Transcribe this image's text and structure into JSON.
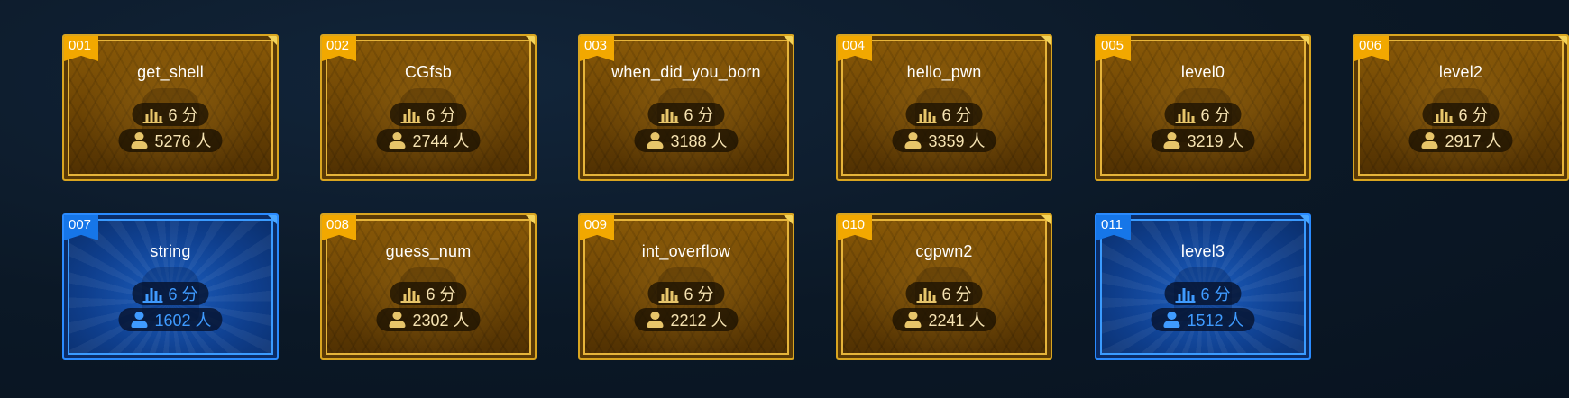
{
  "challenges": [
    {
      "number": "001",
      "name": "get_shell",
      "score": "6 分",
      "solvers": "5276 人",
      "theme": "gold"
    },
    {
      "number": "002",
      "name": "CGfsb",
      "score": "6 分",
      "solvers": "2744 人",
      "theme": "gold"
    },
    {
      "number": "003",
      "name": "when_did_you_born",
      "score": "6 分",
      "solvers": "3188 人",
      "theme": "gold"
    },
    {
      "number": "004",
      "name": "hello_pwn",
      "score": "6 分",
      "solvers": "3359 人",
      "theme": "gold"
    },
    {
      "number": "005",
      "name": "level0",
      "score": "6 分",
      "solvers": "3219 人",
      "theme": "gold"
    },
    {
      "number": "006",
      "name": "level2",
      "score": "6 分",
      "solvers": "2917 人",
      "theme": "gold"
    },
    {
      "number": "007",
      "name": "string",
      "score": "6 分",
      "solvers": "1602 人",
      "theme": "blue"
    },
    {
      "number": "008",
      "name": "guess_num",
      "score": "6 分",
      "solvers": "2302 人",
      "theme": "gold"
    },
    {
      "number": "009",
      "name": "int_overflow",
      "score": "6 分",
      "solvers": "2212 人",
      "theme": "gold"
    },
    {
      "number": "010",
      "name": "cgpwn2",
      "score": "6 分",
      "solvers": "2241 人",
      "theme": "gold"
    },
    {
      "number": "011",
      "name": "level3",
      "score": "6 分",
      "solvers": "1512 人",
      "theme": "blue"
    }
  ],
  "colors": {
    "gold_badge": "#f2a800",
    "blue_badge": "#1676e8",
    "background": "#0b1826"
  },
  "icons": {
    "score": "bar-chart-icon",
    "solvers": "person-icon"
  }
}
